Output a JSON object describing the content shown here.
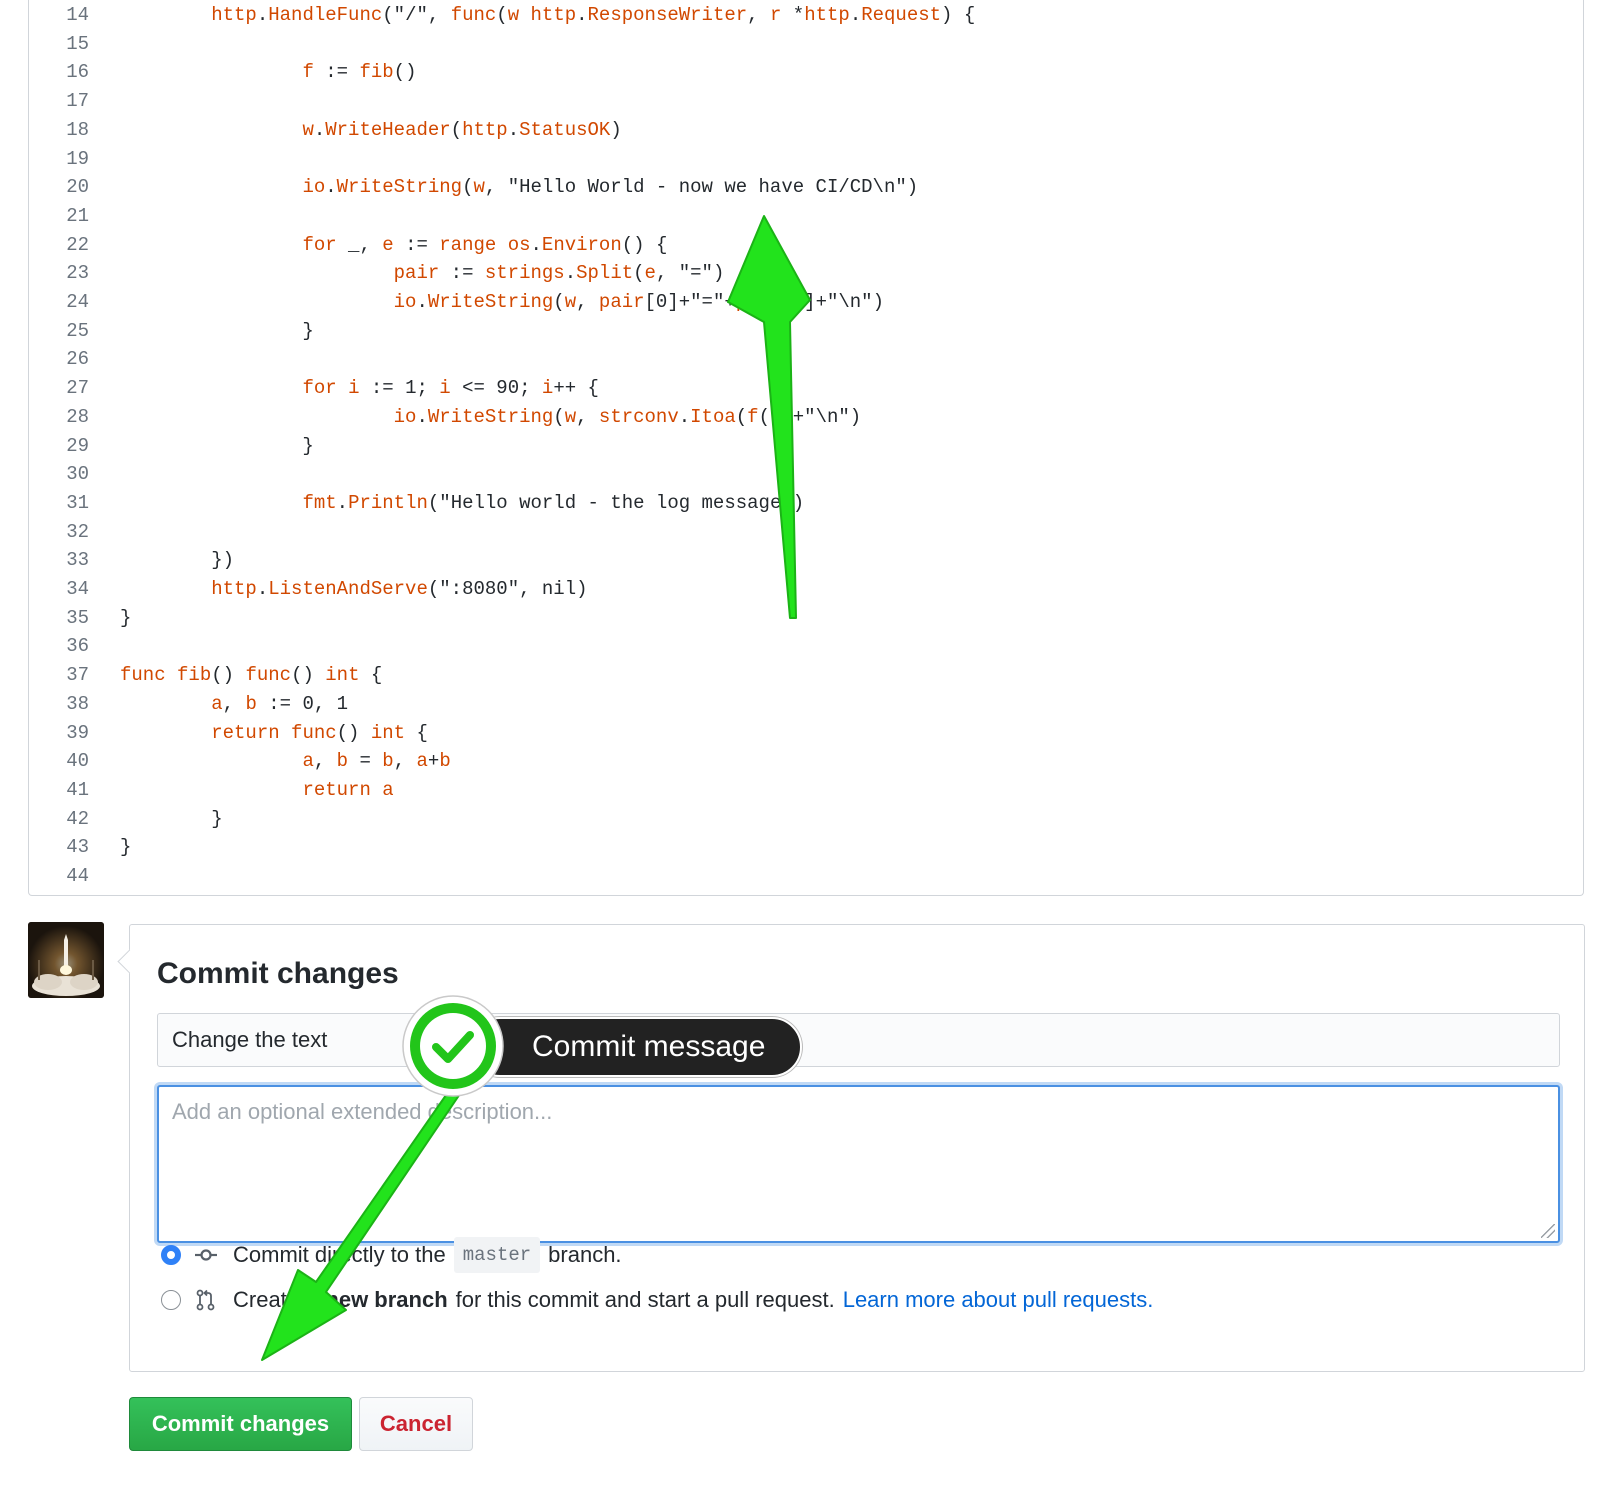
{
  "code": {
    "lines": [
      {
        "n": "14",
        "html": "        <span class='t-o'>http</span>.<span class='t-o'>HandleFunc</span>(\"/\", <span class='t-o'>func</span>(<span class='t-o'>w</span> <span class='t-o'>http</span>.<span class='t-o'>ResponseWriter</span>, <span class='t-o'>r</span> *<span class='t-o'>http</span>.<span class='t-o'>Request</span>) {"
      },
      {
        "n": "15",
        "html": ""
      },
      {
        "n": "16",
        "html": "                <span class='t-o'>f</span> := <span class='t-o'>fib</span>()"
      },
      {
        "n": "17",
        "html": ""
      },
      {
        "n": "18",
        "html": "                <span class='t-o'>w</span>.<span class='t-o'>WriteHeader</span>(<span class='t-o'>http</span>.<span class='t-o'>StatusOK</span>)"
      },
      {
        "n": "19",
        "html": ""
      },
      {
        "n": "20",
        "html": "                <span class='t-o'>io</span>.<span class='t-o'>WriteString</span>(<span class='t-o'>w</span>, \"Hello World - now we have CI/CD\\n\")"
      },
      {
        "n": "21",
        "html": ""
      },
      {
        "n": "22",
        "html": "                <span class='t-o'>for</span> _, <span class='t-o'>e</span> := <span class='t-o'>range</span> <span class='t-o'>os</span>.<span class='t-o'>Environ</span>() {"
      },
      {
        "n": "23",
        "html": "                        <span class='t-o'>pair</span> := <span class='t-o'>strings</span>.<span class='t-o'>Split</span>(<span class='t-o'>e</span>, \"=\")"
      },
      {
        "n": "24",
        "html": "                        <span class='t-o'>io</span>.<span class='t-o'>WriteString</span>(<span class='t-o'>w</span>, <span class='t-o'>pair</span>[0]+\"=\"+<span class='t-o'>pair</span>[1]+\"\\n\")"
      },
      {
        "n": "25",
        "html": "                }"
      },
      {
        "n": "26",
        "html": ""
      },
      {
        "n": "27",
        "html": "                <span class='t-o'>for</span> <span class='t-o'>i</span> := 1; <span class='t-o'>i</span> <= 90; <span class='t-o'>i</span>++ {"
      },
      {
        "n": "28",
        "html": "                        <span class='t-o'>io</span>.<span class='t-o'>WriteString</span>(<span class='t-o'>w</span>, <span class='t-o'>strconv</span>.<span class='t-o'>Itoa</span>(<span class='t-o'>f</span>())+\"\\n\")"
      },
      {
        "n": "29",
        "html": "                }"
      },
      {
        "n": "30",
        "html": ""
      },
      {
        "n": "31",
        "html": "                <span class='t-o'>fmt</span>.<span class='t-o'>Println</span>(\"Hello world - the log message\")"
      },
      {
        "n": "32",
        "html": ""
      },
      {
        "n": "33",
        "html": "        })"
      },
      {
        "n": "34",
        "html": "        <span class='t-o'>http</span>.<span class='t-o'>ListenAndServe</span>(\":8080\", nil)"
      },
      {
        "n": "35",
        "html": "}"
      },
      {
        "n": "36",
        "html": ""
      },
      {
        "n": "37",
        "html": "<span class='t-o'>func</span> <span class='t-o'>fib</span>() <span class='t-o'>func</span>() <span class='t-o'>int</span> {"
      },
      {
        "n": "38",
        "html": "        <span class='t-o'>a</span>, <span class='t-o'>b</span> := 0, 1"
      },
      {
        "n": "39",
        "html": "        <span class='t-o'>return</span> <span class='t-o'>func</span>() <span class='t-o'>int</span> {"
      },
      {
        "n": "40",
        "html": "                <span class='t-o'>a</span>, <span class='t-o'>b</span> = <span class='t-o'>b</span>, <span class='t-o'>a</span>+<span class='t-o'>b</span>"
      },
      {
        "n": "41",
        "html": "                <span class='t-o'>return</span> <span class='t-o'>a</span>"
      },
      {
        "n": "42",
        "html": "        }"
      },
      {
        "n": "43",
        "html": "}"
      },
      {
        "n": "44",
        "html": ""
      }
    ]
  },
  "commit": {
    "title": "Commit changes",
    "summary_value": "Change the text",
    "description_placeholder": "Add an optional extended description...",
    "option_direct": {
      "prefix": "Commit directly to the",
      "branch": "master",
      "suffix": "branch."
    },
    "option_new_branch": {
      "prefix": "Create a",
      "bold": "new branch",
      "suffix": "for this commit and start a pull request.",
      "link": "Learn more about pull requests."
    },
    "commit_button": "Commit changes",
    "cancel_button": "Cancel"
  },
  "annotation": {
    "tooltip": "Commit message"
  },
  "colors": {
    "keyword": "#d14800",
    "accent_blue": "#0366d6",
    "commit_green": "#28a745",
    "cancel_red": "#cb2431",
    "annotation_arrow": "#22e31c"
  },
  "icons": {
    "commit_option_direct": "git-commit-icon",
    "commit_option_branch": "git-pull-request-icon",
    "annotation_badge": "checkmark-icon"
  }
}
